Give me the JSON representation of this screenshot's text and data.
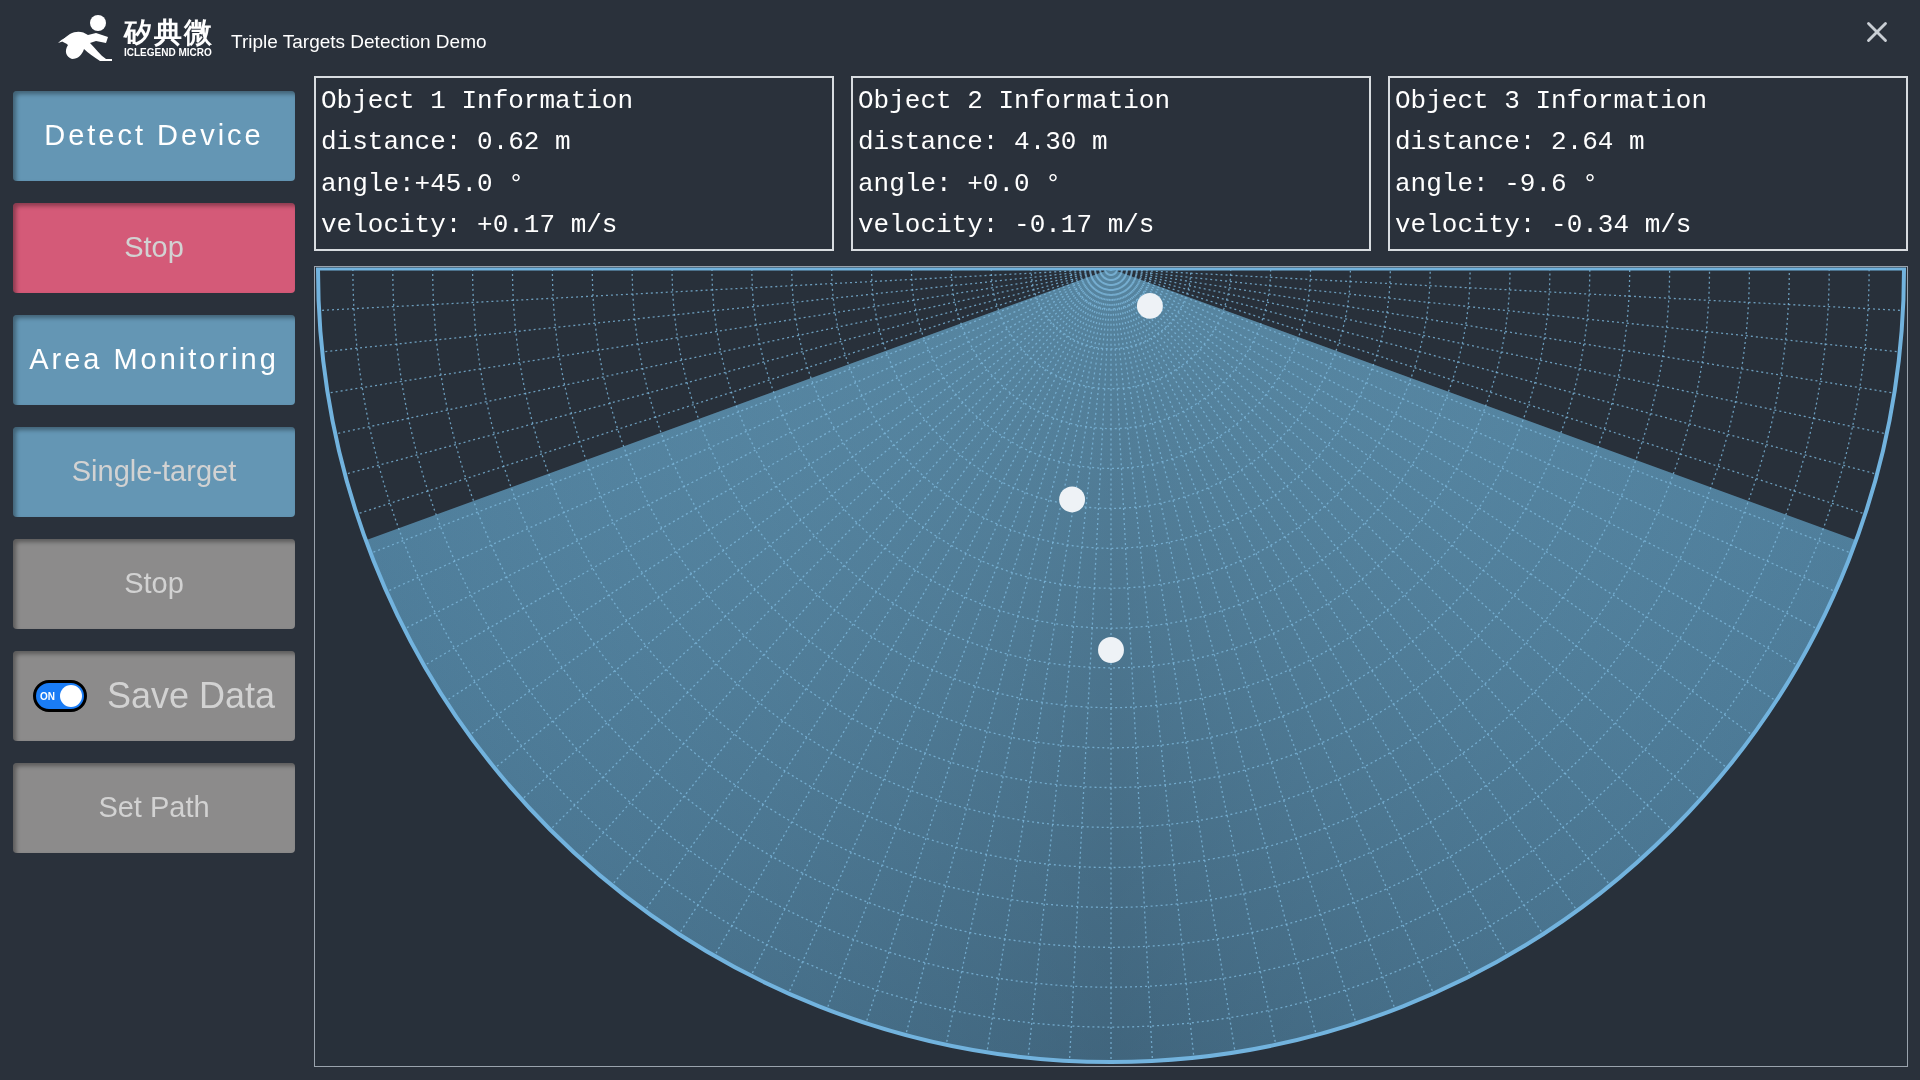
{
  "header": {
    "logo_cn": "矽典微",
    "logo_en": "ICLEGEND MICRO",
    "title": "Triple Targets Detection Demo"
  },
  "buttons": [
    {
      "kind": "button",
      "label": "Detect Device",
      "color": "#6496b4",
      "disabled": false
    },
    {
      "kind": "button",
      "label": "Stop",
      "color": "#d45a78",
      "disabled": true
    },
    {
      "kind": "button",
      "label": "Area Monitoring",
      "color": "#6496b4",
      "disabled": false
    },
    {
      "kind": "button",
      "label": "Single-target",
      "color": "#6496b4",
      "disabled": true
    },
    {
      "kind": "button",
      "label": "Stop",
      "color": "#8c8b8b",
      "disabled": true
    },
    {
      "kind": "toggle",
      "label": "Save Data",
      "color": "#8c8b8b",
      "disabled": true,
      "toggle": {
        "text": "ON",
        "on": true
      }
    },
    {
      "kind": "button",
      "label": "Set Path",
      "color": "#8c8b8b",
      "disabled": true
    }
  ],
  "objects": [
    {
      "title": "Object 1 Information",
      "lines": [
        "distance: 0.62 m",
        "angle:+45.0 °",
        "velocity: +0.17 m/s"
      ]
    },
    {
      "title": "Object 2 Information",
      "lines": [
        "distance: 4.30 m",
        "angle: +0.0 °",
        "velocity: -0.17 m/s"
      ]
    },
    {
      "title": "Object 3 Information",
      "lines": [
        "distance: 2.64 m",
        "angle: -9.6 °",
        "velocity: -0.34 m/s"
      ]
    }
  ]
}
